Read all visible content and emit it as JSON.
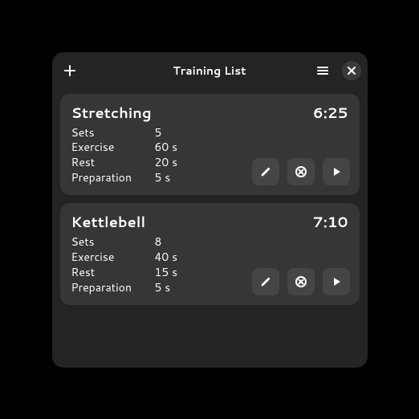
{
  "header": {
    "title": "Training List"
  },
  "trainings": [
    {
      "name": "Stretching",
      "duration": "6:25",
      "fields": {
        "sets_label": "Sets",
        "sets_value": "5",
        "exercise_label": "Exercise",
        "exercise_value": "60 s",
        "rest_label": "Rest",
        "rest_value": "20 s",
        "preparation_label": "Preparation",
        "preparation_value": "5 s"
      }
    },
    {
      "name": "Kettlebell",
      "duration": "7:10",
      "fields": {
        "sets_label": "Sets",
        "sets_value": "8",
        "exercise_label": "Exercise",
        "exercise_value": "40 s",
        "rest_label": "Rest",
        "rest_value": "15 s",
        "preparation_label": "Preparation",
        "preparation_value": "5 s"
      }
    }
  ]
}
